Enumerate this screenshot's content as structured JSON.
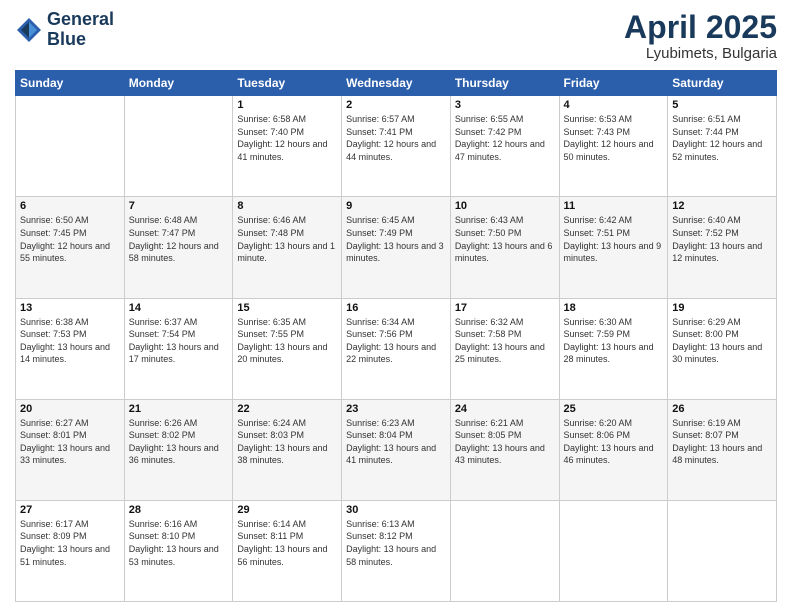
{
  "header": {
    "logo_line1": "General",
    "logo_line2": "Blue",
    "title": "April 2025",
    "subtitle": "Lyubimets, Bulgaria"
  },
  "days_of_week": [
    "Sunday",
    "Monday",
    "Tuesday",
    "Wednesday",
    "Thursday",
    "Friday",
    "Saturday"
  ],
  "weeks": [
    [
      {
        "day": "",
        "info": ""
      },
      {
        "day": "",
        "info": ""
      },
      {
        "day": "1",
        "info": "Sunrise: 6:58 AM\nSunset: 7:40 PM\nDaylight: 12 hours and 41 minutes."
      },
      {
        "day": "2",
        "info": "Sunrise: 6:57 AM\nSunset: 7:41 PM\nDaylight: 12 hours and 44 minutes."
      },
      {
        "day": "3",
        "info": "Sunrise: 6:55 AM\nSunset: 7:42 PM\nDaylight: 12 hours and 47 minutes."
      },
      {
        "day": "4",
        "info": "Sunrise: 6:53 AM\nSunset: 7:43 PM\nDaylight: 12 hours and 50 minutes."
      },
      {
        "day": "5",
        "info": "Sunrise: 6:51 AM\nSunset: 7:44 PM\nDaylight: 12 hours and 52 minutes."
      }
    ],
    [
      {
        "day": "6",
        "info": "Sunrise: 6:50 AM\nSunset: 7:45 PM\nDaylight: 12 hours and 55 minutes."
      },
      {
        "day": "7",
        "info": "Sunrise: 6:48 AM\nSunset: 7:47 PM\nDaylight: 12 hours and 58 minutes."
      },
      {
        "day": "8",
        "info": "Sunrise: 6:46 AM\nSunset: 7:48 PM\nDaylight: 13 hours and 1 minute."
      },
      {
        "day": "9",
        "info": "Sunrise: 6:45 AM\nSunset: 7:49 PM\nDaylight: 13 hours and 3 minutes."
      },
      {
        "day": "10",
        "info": "Sunrise: 6:43 AM\nSunset: 7:50 PM\nDaylight: 13 hours and 6 minutes."
      },
      {
        "day": "11",
        "info": "Sunrise: 6:42 AM\nSunset: 7:51 PM\nDaylight: 13 hours and 9 minutes."
      },
      {
        "day": "12",
        "info": "Sunrise: 6:40 AM\nSunset: 7:52 PM\nDaylight: 13 hours and 12 minutes."
      }
    ],
    [
      {
        "day": "13",
        "info": "Sunrise: 6:38 AM\nSunset: 7:53 PM\nDaylight: 13 hours and 14 minutes."
      },
      {
        "day": "14",
        "info": "Sunrise: 6:37 AM\nSunset: 7:54 PM\nDaylight: 13 hours and 17 minutes."
      },
      {
        "day": "15",
        "info": "Sunrise: 6:35 AM\nSunset: 7:55 PM\nDaylight: 13 hours and 20 minutes."
      },
      {
        "day": "16",
        "info": "Sunrise: 6:34 AM\nSunset: 7:56 PM\nDaylight: 13 hours and 22 minutes."
      },
      {
        "day": "17",
        "info": "Sunrise: 6:32 AM\nSunset: 7:58 PM\nDaylight: 13 hours and 25 minutes."
      },
      {
        "day": "18",
        "info": "Sunrise: 6:30 AM\nSunset: 7:59 PM\nDaylight: 13 hours and 28 minutes."
      },
      {
        "day": "19",
        "info": "Sunrise: 6:29 AM\nSunset: 8:00 PM\nDaylight: 13 hours and 30 minutes."
      }
    ],
    [
      {
        "day": "20",
        "info": "Sunrise: 6:27 AM\nSunset: 8:01 PM\nDaylight: 13 hours and 33 minutes."
      },
      {
        "day": "21",
        "info": "Sunrise: 6:26 AM\nSunset: 8:02 PM\nDaylight: 13 hours and 36 minutes."
      },
      {
        "day": "22",
        "info": "Sunrise: 6:24 AM\nSunset: 8:03 PM\nDaylight: 13 hours and 38 minutes."
      },
      {
        "day": "23",
        "info": "Sunrise: 6:23 AM\nSunset: 8:04 PM\nDaylight: 13 hours and 41 minutes."
      },
      {
        "day": "24",
        "info": "Sunrise: 6:21 AM\nSunset: 8:05 PM\nDaylight: 13 hours and 43 minutes."
      },
      {
        "day": "25",
        "info": "Sunrise: 6:20 AM\nSunset: 8:06 PM\nDaylight: 13 hours and 46 minutes."
      },
      {
        "day": "26",
        "info": "Sunrise: 6:19 AM\nSunset: 8:07 PM\nDaylight: 13 hours and 48 minutes."
      }
    ],
    [
      {
        "day": "27",
        "info": "Sunrise: 6:17 AM\nSunset: 8:09 PM\nDaylight: 13 hours and 51 minutes."
      },
      {
        "day": "28",
        "info": "Sunrise: 6:16 AM\nSunset: 8:10 PM\nDaylight: 13 hours and 53 minutes."
      },
      {
        "day": "29",
        "info": "Sunrise: 6:14 AM\nSunset: 8:11 PM\nDaylight: 13 hours and 56 minutes."
      },
      {
        "day": "30",
        "info": "Sunrise: 6:13 AM\nSunset: 8:12 PM\nDaylight: 13 hours and 58 minutes."
      },
      {
        "day": "",
        "info": ""
      },
      {
        "day": "",
        "info": ""
      },
      {
        "day": "",
        "info": ""
      }
    ]
  ]
}
